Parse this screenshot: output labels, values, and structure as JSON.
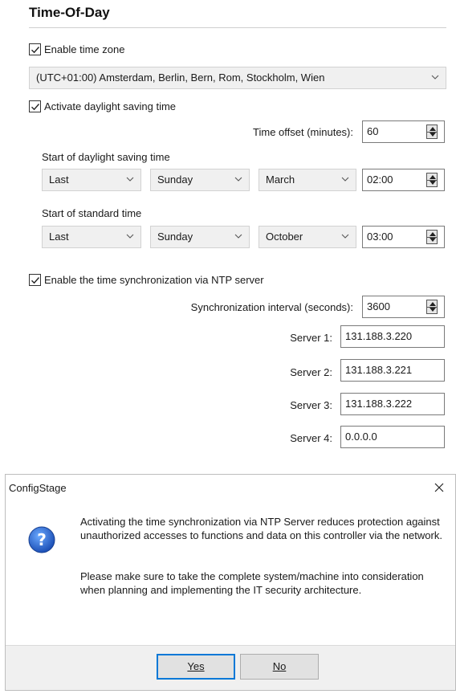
{
  "section": {
    "title": "Time-Of-Day"
  },
  "timezone": {
    "enable_label": "Enable time zone",
    "enabled": true,
    "selected": "(UTC+01:00) Amsterdam, Berlin, Bern, Rom, Stockholm, Wien"
  },
  "dst": {
    "activate_label": "Activate daylight saving time",
    "enabled": true,
    "offset_label": "Time offset (minutes):",
    "offset_value": "60",
    "start_dst_label": "Start of daylight saving time",
    "start_dst": {
      "week": "Last",
      "day": "Sunday",
      "month": "March",
      "time": "02:00"
    },
    "start_std_label": "Start of standard time",
    "start_std": {
      "week": "Last",
      "day": "Sunday",
      "month": "October",
      "time": "03:00"
    }
  },
  "ntp": {
    "enable_label": "Enable the time synchronization via NTP server",
    "enabled": true,
    "interval_label": "Synchronization interval (seconds):",
    "interval_value": "3600",
    "servers": [
      {
        "label": "Server 1:",
        "value": "131.188.3.220"
      },
      {
        "label": "Server 2:",
        "value": "131.188.3.221"
      },
      {
        "label": "Server 3:",
        "value": "131.188.3.222"
      },
      {
        "label": "Server 4:",
        "value": "0.0.0.0"
      }
    ]
  },
  "dialog": {
    "title": "ConfigStage",
    "message_1": "Activating the time synchronization via NTP Server reduces protection against unauthorized accesses to functions and data on this controller via the network.",
    "message_2": "Please make sure to take the complete system/machine into consideration when planning and implementing the IT security architecture.",
    "yes_label": "Yes",
    "no_label": "No",
    "icon": "question-icon"
  }
}
